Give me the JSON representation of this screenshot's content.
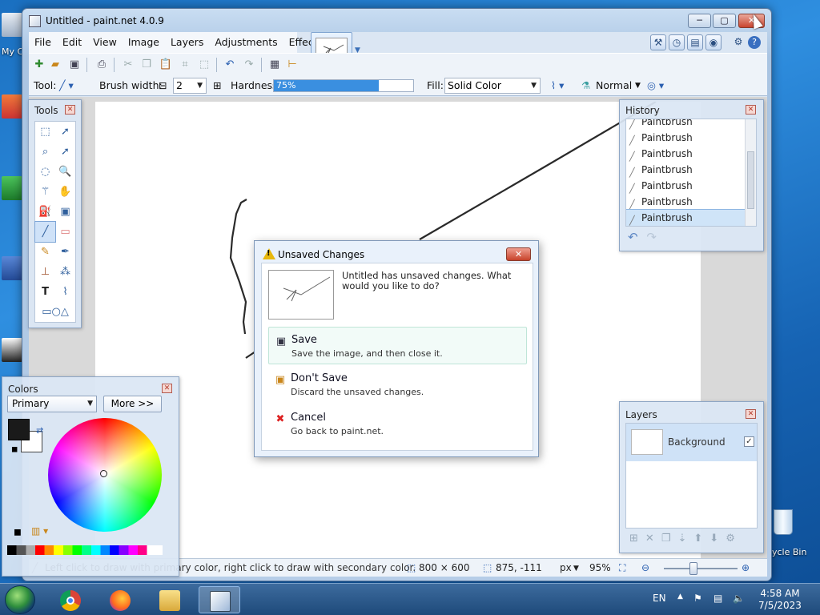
{
  "window": {
    "title": "Untitled - paint.net 4.0.9",
    "min_glyph": "─",
    "max_glyph": "▢",
    "close_glyph": "✕"
  },
  "menu": [
    "File",
    "Edit",
    "View",
    "Image",
    "Layers",
    "Adjustments",
    "Effects"
  ],
  "options": {
    "tool_label": "Tool:",
    "brush_width_label": "Brush width:",
    "brush_width": "2",
    "hardness_label": "Hardness:",
    "hardness": "75%",
    "hardness_fraction": 0.75,
    "fill_label": "Fill:",
    "fill": "Solid Color",
    "blend_mode": "Normal"
  },
  "tools_panel": {
    "title": "Tools",
    "tools": [
      "rectangle-select",
      "move-selection",
      "lasso-select",
      "move-selected",
      "ellipse-select",
      "zoom",
      "magic-wand",
      "pan",
      "paint-bucket",
      "gradient",
      "paintbrush",
      "eraser",
      "pencil",
      "color-picker",
      "clone-stamp",
      "recolor",
      "text",
      "line-curve",
      "shapes"
    ],
    "selected": "paintbrush"
  },
  "history": {
    "title": "History",
    "items": [
      "Paintbrush",
      "Paintbrush",
      "Paintbrush",
      "Paintbrush",
      "Paintbrush",
      "Paintbrush",
      "Paintbrush"
    ],
    "selected_index": 6
  },
  "layers": {
    "title": "Layers",
    "items": [
      {
        "name": "Background",
        "visible": true
      }
    ]
  },
  "colors": {
    "title": "Colors",
    "mode": "Primary",
    "more_label": "More >>",
    "primary": "#1a1a1a",
    "secondary": "#ffffff"
  },
  "dialog": {
    "title": "Unsaved Changes",
    "message": "Untitled has unsaved changes. What would you like to do?",
    "options": [
      {
        "label": "Save",
        "desc": "Save the image, and then close it.",
        "icon": "save-icon"
      },
      {
        "label": "Don't Save",
        "desc": "Discard the unsaved changes.",
        "icon": "discard-icon"
      },
      {
        "label": "Cancel",
        "desc": "Go back to paint.net.",
        "icon": "cancel-icon"
      }
    ]
  },
  "status": {
    "hint": "Left click to draw with primary color, right click to draw with secondary color.",
    "image_size": "800 × 600",
    "cursor_pos": "875, -111",
    "units": "px",
    "zoom": "95%"
  },
  "desktop": {
    "label_my_computer": "My C",
    "label_recycle": "ycle Bin"
  },
  "taskbar": {
    "apps": [
      "start",
      "chrome",
      "firefox",
      "file-explorer",
      "paint.net"
    ],
    "lang": "EN",
    "time": "4:58 AM",
    "date": "7/5/2023"
  },
  "accent": "#3a8fe0"
}
